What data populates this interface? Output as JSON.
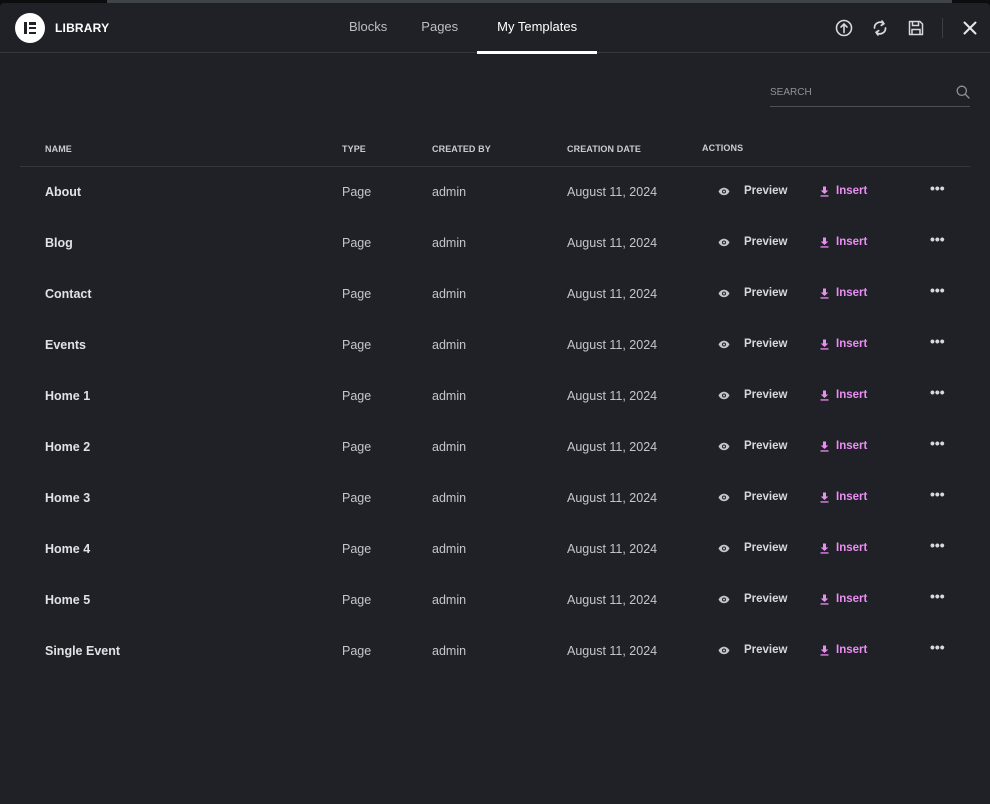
{
  "header": {
    "logo_text": "LIBRARY",
    "tabs": [
      {
        "label": "Blocks",
        "active": false
      },
      {
        "label": "Pages",
        "active": false
      },
      {
        "label": "My Templates",
        "active": true
      }
    ],
    "icons": [
      "upload-icon",
      "sync-icon",
      "save-icon",
      "close-icon"
    ]
  },
  "search": {
    "placeholder": "SEARCH",
    "value": ""
  },
  "table": {
    "columns": {
      "name": "NAME",
      "type": "TYPE",
      "created_by": "CREATED BY",
      "creation_date": "CREATION DATE",
      "actions": "ACTIONS"
    },
    "preview_label": "Preview",
    "insert_label": "Insert",
    "more_label": "•••",
    "rows": [
      {
        "name": "About",
        "type": "Page",
        "created_by": "admin",
        "date": "August 11, 2024"
      },
      {
        "name": "Blog",
        "type": "Page",
        "created_by": "admin",
        "date": "August 11, 2024"
      },
      {
        "name": "Contact",
        "type": "Page",
        "created_by": "admin",
        "date": "August 11, 2024"
      },
      {
        "name": "Events",
        "type": "Page",
        "created_by": "admin",
        "date": "August 11, 2024"
      },
      {
        "name": "Home 1",
        "type": "Page",
        "created_by": "admin",
        "date": "August 11, 2024"
      },
      {
        "name": "Home 2",
        "type": "Page",
        "created_by": "admin",
        "date": "August 11, 2024"
      },
      {
        "name": "Home 3",
        "type": "Page",
        "created_by": "admin",
        "date": "August 11, 2024"
      },
      {
        "name": "Home 4",
        "type": "Page",
        "created_by": "admin",
        "date": "August 11, 2024"
      },
      {
        "name": "Home 5",
        "type": "Page",
        "created_by": "admin",
        "date": "August 11, 2024"
      },
      {
        "name": "Single Event",
        "type": "Page",
        "created_by": "admin",
        "date": "August 11, 2024"
      }
    ]
  },
  "colors": {
    "background": "#202126",
    "accent_insert": "#e98ef2",
    "text": "#d5d8dc",
    "divider": "#34383e"
  }
}
